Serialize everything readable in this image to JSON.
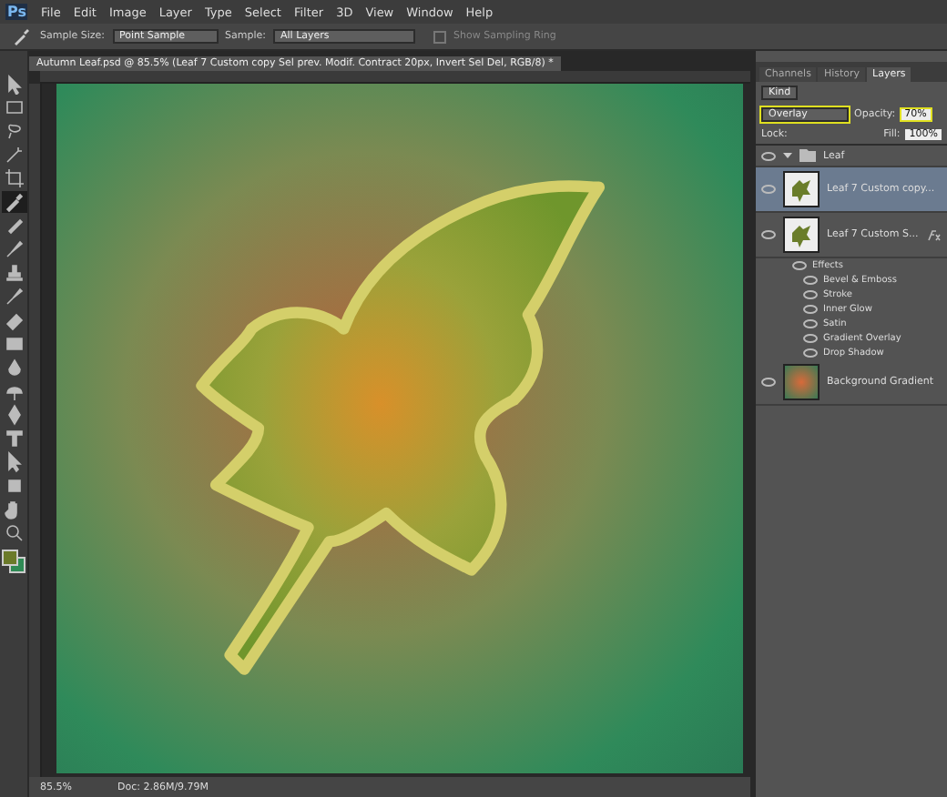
{
  "app": {
    "logo": "Ps"
  },
  "menu": [
    "File",
    "Edit",
    "Image",
    "Layer",
    "Type",
    "Select",
    "Filter",
    "3D",
    "View",
    "Window",
    "Help"
  ],
  "options_bar": {
    "sample_size_label": "Sample Size:",
    "sample_size": "Point Sample",
    "sample_label": "Sample:",
    "sample": "All Layers",
    "sampling_ring": {
      "label": "Show Sampling Ring",
      "checked": false,
      "disabled": true
    }
  },
  "document": {
    "title": "Autumn Leaf.psd @ 85.5% (Leaf 7 Custom copy Sel prev. Modif. Contract 20px, Invert Sel Del, RGB/8) *"
  },
  "tools": [
    {
      "kind": "move",
      "selected": false
    },
    {
      "kind": "marquee",
      "selected": false
    },
    {
      "kind": "lasso",
      "selected": false
    },
    {
      "kind": "wand",
      "selected": false
    },
    {
      "kind": "crop",
      "selected": false
    },
    {
      "kind": "eyedropper",
      "selected": true
    },
    {
      "kind": "healing",
      "selected": false
    },
    {
      "kind": "brush",
      "selected": false
    },
    {
      "kind": "stamp",
      "selected": false
    },
    {
      "kind": "history",
      "selected": false
    },
    {
      "kind": "eraser",
      "selected": false
    },
    {
      "kind": "gradient",
      "selected": false
    },
    {
      "kind": "blur",
      "selected": false
    },
    {
      "kind": "dodge",
      "selected": false
    },
    {
      "kind": "pen",
      "selected": false
    },
    {
      "kind": "type",
      "selected": false
    },
    {
      "kind": "select",
      "selected": false
    },
    {
      "kind": "shape",
      "selected": false
    },
    {
      "kind": "hand",
      "selected": false
    },
    {
      "kind": "zoom",
      "selected": false
    }
  ],
  "panel": {
    "tabs": [
      {
        "label": "Channels",
        "selected": false
      },
      {
        "label": "History",
        "selected": false
      },
      {
        "label": "Layers",
        "selected": true
      }
    ],
    "filter": "Kind",
    "blend_mode": "Overlay",
    "opacity_label": "Opacity:",
    "opacity": "70%",
    "lock_label": "Lock:",
    "fill_label": "Fill:",
    "fill": "100%",
    "layers": [
      {
        "kind": "group",
        "name": "Leaf",
        "expanded": true,
        "children": [
          {
            "name": "Leaf 7 Custom copy...",
            "selected": true,
            "fx": false
          },
          {
            "name": "Leaf 7 Custom S...",
            "selected": false,
            "fx": true,
            "effects_label": "Effects",
            "effects": [
              "Bevel & Emboss",
              "Stroke",
              "Inner Glow",
              "Satin",
              "Gradient Overlay",
              "Drop Shadow"
            ]
          }
        ]
      },
      {
        "kind": "background",
        "name": "Background Gradient"
      }
    ]
  },
  "status_bar": {
    "zoom": "85.5%",
    "doc": "Doc: 2.86M/9.79M"
  }
}
